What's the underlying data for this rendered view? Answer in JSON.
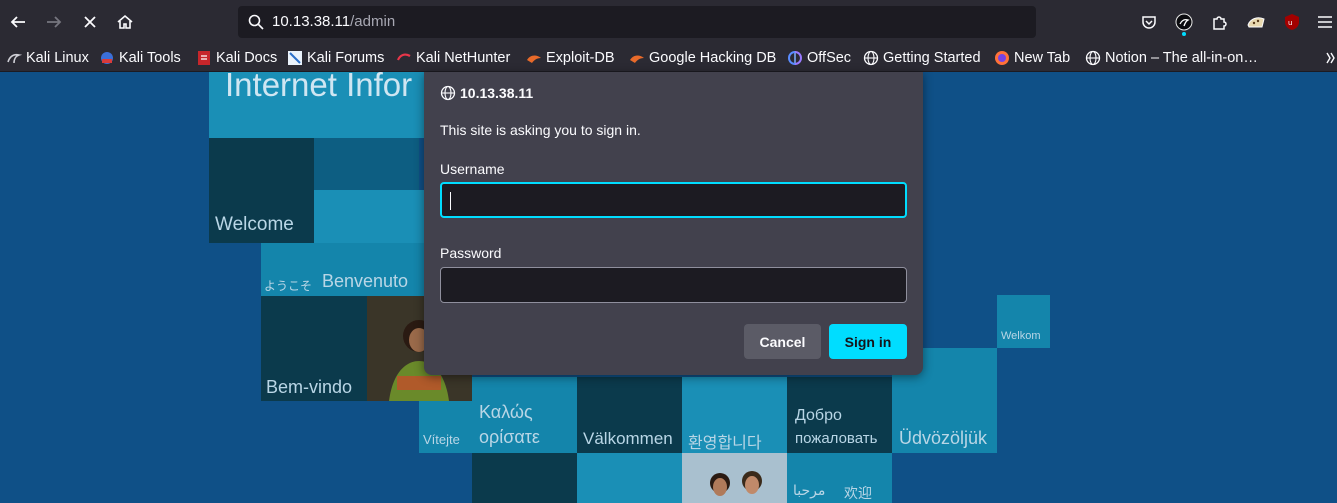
{
  "browser": {
    "url_host": "10.13.38.11",
    "url_path": "/admin",
    "bookmarks": [
      {
        "label": "Kali Linux",
        "icon": "kali-dragon-icon"
      },
      {
        "label": "Kali Tools",
        "icon": "kali-tools-icon"
      },
      {
        "label": "Kali Docs",
        "icon": "kali-docs-icon"
      },
      {
        "label": "Kali Forums",
        "icon": "kali-forums-icon"
      },
      {
        "label": "Kali NetHunter",
        "icon": "nethunter-icon"
      },
      {
        "label": "Exploit-DB",
        "icon": "exploit-db-icon"
      },
      {
        "label": "Google Hacking DB",
        "icon": "ghdb-icon"
      },
      {
        "label": "OffSec",
        "icon": "offsec-icon"
      },
      {
        "label": "Getting Started",
        "icon": "globe-icon"
      },
      {
        "label": "New Tab",
        "icon": "firefox-icon"
      },
      {
        "label": "Notion – The all-in-on…",
        "icon": "globe-icon"
      }
    ]
  },
  "page": {
    "title_fragment": "Internet Infor",
    "greetings": {
      "welcome": "Welcome",
      "japanese": "ようこそ",
      "italian": "Benvenuto",
      "portuguese": "Bem-vindo",
      "greek_1": "Καλώς",
      "greek_2": "ορίσατε",
      "czech": "Vítejte",
      "swedish": "Välkommen",
      "korean": "환영합니다",
      "russian_1": "Добро",
      "russian_2": "пожаловать",
      "hungarian": "Üdvözöljük",
      "dutch": "Welkom",
      "arabic": "مرحبا",
      "chinese": "欢迎"
    }
  },
  "dialog": {
    "host": "10.13.38.11",
    "message": "This site is asking you to sign in.",
    "username_label": "Username",
    "username_value": "",
    "password_label": "Password",
    "password_value": "",
    "cancel_label": "Cancel",
    "signin_label": "Sign in"
  },
  "colors": {
    "accent": "#00ddff",
    "toolbar": "#2b2a33",
    "dialog": "#42414d",
    "page_bg": "#0f5087"
  }
}
